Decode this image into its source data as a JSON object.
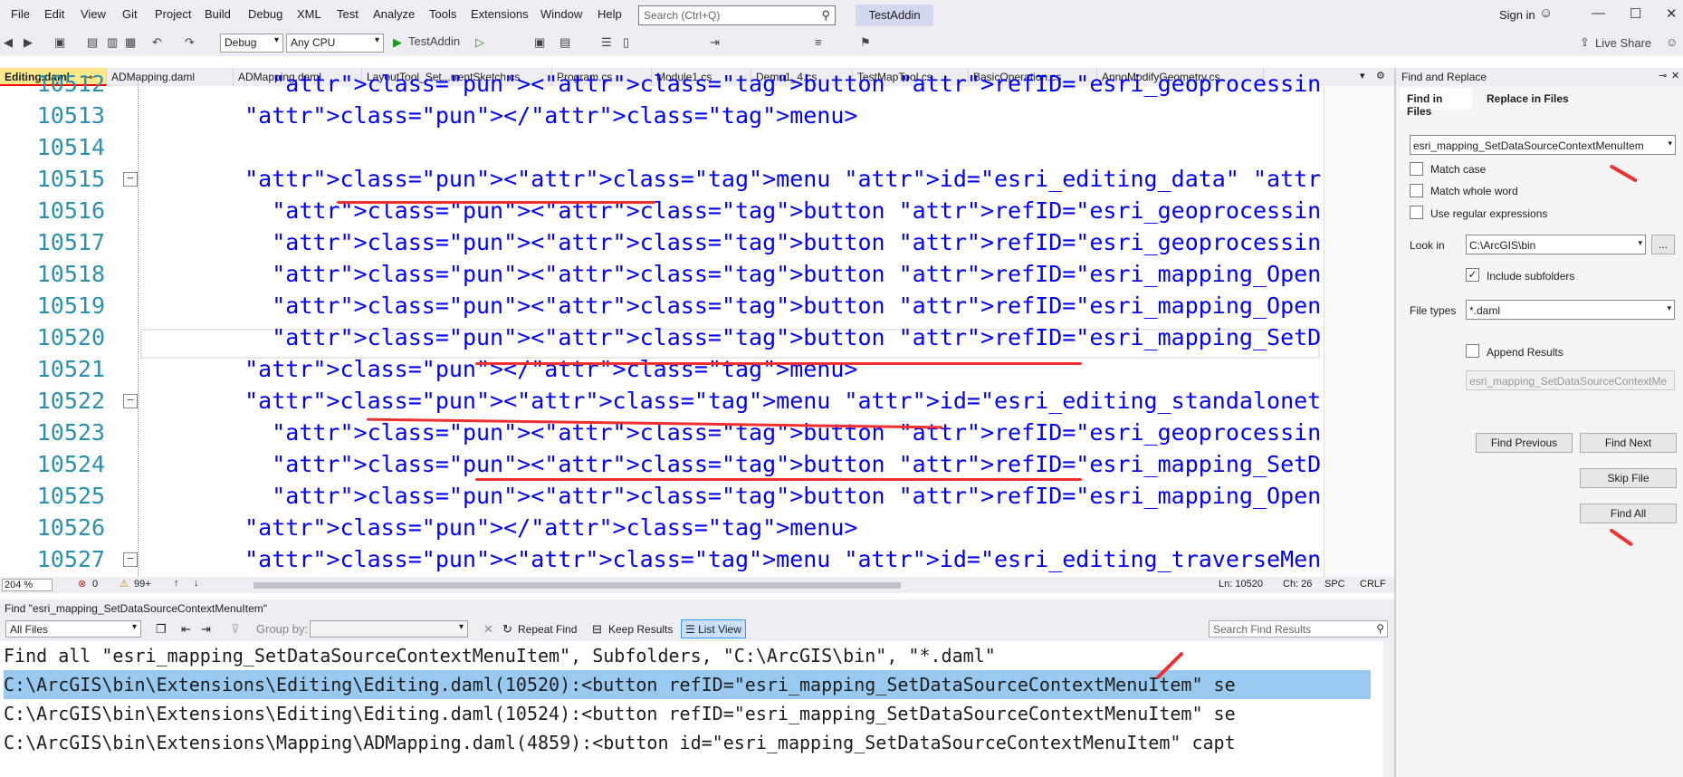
{
  "menubar": {
    "items": [
      "File",
      "Edit",
      "View",
      "Git",
      "Project",
      "Build",
      "Debug",
      "XML",
      "Test",
      "Analyze",
      "Tools",
      "Extensions",
      "Window",
      "Help"
    ],
    "search_placeholder": "Search (Ctrl+Q)",
    "project_name": "TestAddin",
    "sign_in": "Sign in",
    "live_share": "Live Share"
  },
  "toolbar": {
    "config": "Debug",
    "platform": "Any CPU",
    "run_label": "TestAddin"
  },
  "tabs": [
    "Editing.daml",
    "ADMapping.daml",
    "ADMapping.daml",
    "LayoutTool_Set...rrentSketch.cs",
    "Program.cs",
    "Module1.cs",
    "Demo1_4.cs",
    "TestMapTool.cs",
    "BasicOperation.cs",
    "AnnoModifyGeometry.cs"
  ],
  "editor": {
    "lines": [
      {
        "n": "10512",
        "t": "    <button refID=\"esri_geoprocessing_tableExportTableButton\"/>"
      },
      {
        "n": "10513",
        "t": "  </menu>"
      },
      {
        "n": "10514",
        "t": ""
      },
      {
        "n": "10515",
        "t": "  <menu id=\"esri_editing_data\" caption=\"Data\" contextMenu=\"true\">"
      },
      {
        "n": "10516",
        "t": "    <button refID=\"esri_geoprocessing_exportDataButton\"/>"
      },
      {
        "n": "10517",
        "t": "    <button refID=\"esri_geoprocessing_tableExportTableButton\"/>"
      },
      {
        "n": "10518",
        "t": "    <button refID=\"esri_mapping_OpenRematchTableContextMenuItem\" separator=\"tr"
      },
      {
        "n": "10519",
        "t": "    <button refID=\"esri_mapping_OpenSplitAddressReviewButton\"/>"
      },
      {
        "n": "10520",
        "t": "    <button refID=\"esri_mapping_SetDataSourceContextMenuItem\" separator=\"true\""
      },
      {
        "n": "10521",
        "t": "  </menu>"
      },
      {
        "n": "10522",
        "t": "  <menu id=\"esri_editing_standalonetable_data_menu\" caption=\"Data\" contextMenu"
      },
      {
        "n": "10523",
        "t": "    <button refID=\"esri_geoprocessing_tableExportTableButton\"/>"
      },
      {
        "n": "10524",
        "t": "    <button refID=\"esri_mapping_SetDataSourceContextMenuItem\" separator=\"true\""
      },
      {
        "n": "10525",
        "t": "    <button refID=\"esri_mapping_OpenSplitAddressReviewButton\" separator=\"true\""
      },
      {
        "n": "10526",
        "t": "  </menu>"
      },
      {
        "n": "10527",
        "t": "  <menu id=\"esri_editing_traverseMenu\" caption=\"Traverse\" contextMenu=\"true\">"
      }
    ]
  },
  "status": {
    "zoom": "204 %",
    "errors": "0",
    "warnings": "99+",
    "ln": "Ln: 10520",
    "ch": "Ch: 26",
    "spc": "SPC",
    "crlf": "CRLF"
  },
  "find_results": {
    "title": "Find \"esri_mapping_SetDataSourceContextMenuItem\"",
    "scope": "All Files",
    "group_by": "Group by:",
    "repeat_find": "Repeat Find",
    "keep_results": "Keep Results",
    "list_view": "List View",
    "search_placeholder": "Search Find Results",
    "lines": [
      "Find all \"esri_mapping_SetDataSourceContextMenuItem\", Subfolders, \"C:\\ArcGIS\\bin\", \"*.daml\"",
      "C:\\ArcGIS\\bin\\Extensions\\Editing\\Editing.daml(10520):<button refID=\"esri_mapping_SetDataSourceContextMenuItem\" se",
      "C:\\ArcGIS\\bin\\Extensions\\Editing\\Editing.daml(10524):<button refID=\"esri_mapping_SetDataSourceContextMenuItem\" se",
      "C:\\ArcGIS\\bin\\Extensions\\Mapping\\ADMapping.daml(4859):<button id=\"esri_mapping_SetDataSourceContextMenuItem\" capt"
    ]
  },
  "find_replace": {
    "title": "Find and Replace",
    "tab_find": "Find in Files",
    "tab_replace": "Replace in Files",
    "query": "esri_mapping_SetDataSourceContextMenuItem",
    "match_case": "Match case",
    "whole_word": "Match whole word",
    "regex": "Use regular expressions",
    "look_in_label": "Look in",
    "look_in": "C:\\ArcGIS\\bin",
    "include_subfolders": "Include subfolders",
    "file_types_label": "File types",
    "file_types": "*.daml",
    "append_results": "Append Results",
    "append_value": "esri_mapping_SetDataSourceContextMe",
    "find_previous": "Find Previous",
    "find_next": "Find Next",
    "skip_file": "Skip File",
    "find_all": "Find All"
  }
}
